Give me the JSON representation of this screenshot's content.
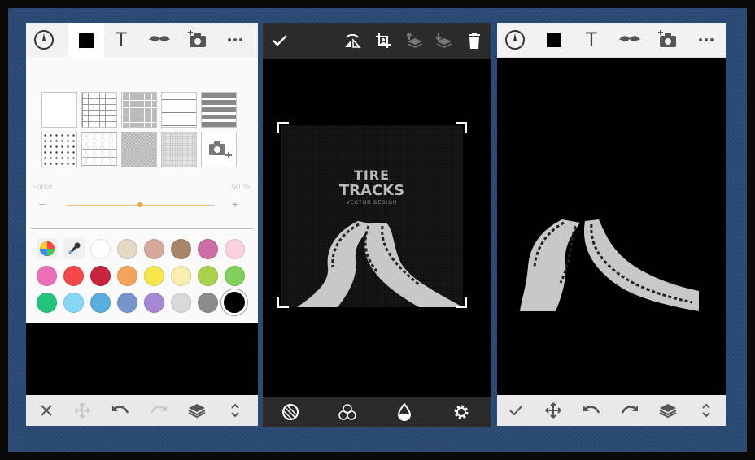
{
  "left_panel": {
    "toolbar_icons": [
      "compass-icon",
      "color-square-icon",
      "text-icon",
      "mustache-icon",
      "add-photo-icon",
      "more-icon"
    ],
    "text_tool_label": "T",
    "patterns": [
      "blank",
      "grid-small",
      "grid-large",
      "lines-thin",
      "lines-thick",
      "dots",
      "triangles",
      "canvas-texture",
      "paper-texture",
      "add-photo"
    ],
    "force_label": "Force",
    "force_value": "50 %",
    "force_level": 0.5,
    "minus_label": "−",
    "plus_label": "+",
    "swatches": [
      "#ffffff",
      "#e3d9c6",
      "#d7a99b",
      "#a88568",
      "#cc6fa6",
      "#f9d2de",
      "#ec6fb7",
      "#f44848",
      "#c8243e",
      "#f5a35b",
      "#f6e84a",
      "#f8eeb0",
      "#a9d24b",
      "#7fd15b",
      "#21c47a",
      "#86d7f7",
      "#59aee0",
      "#7496cd",
      "#a587d6",
      "#d9d9d9",
      "#8c8c8c",
      "#000000"
    ],
    "bottom_icons": [
      "close-icon",
      "move-icon",
      "undo-icon",
      "redo-icon",
      "layers-icon",
      "expand-icon"
    ]
  },
  "middle_panel": {
    "toolbar_icons": [
      "check-icon",
      "flip-icon",
      "crop-icon",
      "layer-up-icon",
      "layer-down-icon",
      "trash-icon"
    ],
    "poster": {
      "line1": "TIRE",
      "line2": "TRACKS",
      "line3": "VECTOR DESIGN"
    },
    "bottom_icons": [
      "blend-icon",
      "colors-icon",
      "opacity-icon",
      "settings-icon"
    ]
  },
  "right_panel": {
    "toolbar_icons": [
      "compass-icon",
      "color-square-icon",
      "text-icon",
      "mustache-icon",
      "add-photo-icon",
      "more-icon"
    ],
    "text_tool_label": "T",
    "bottom_icons": [
      "check-icon",
      "move-icon",
      "undo-icon",
      "redo-icon",
      "layers-icon",
      "expand-icon"
    ]
  }
}
